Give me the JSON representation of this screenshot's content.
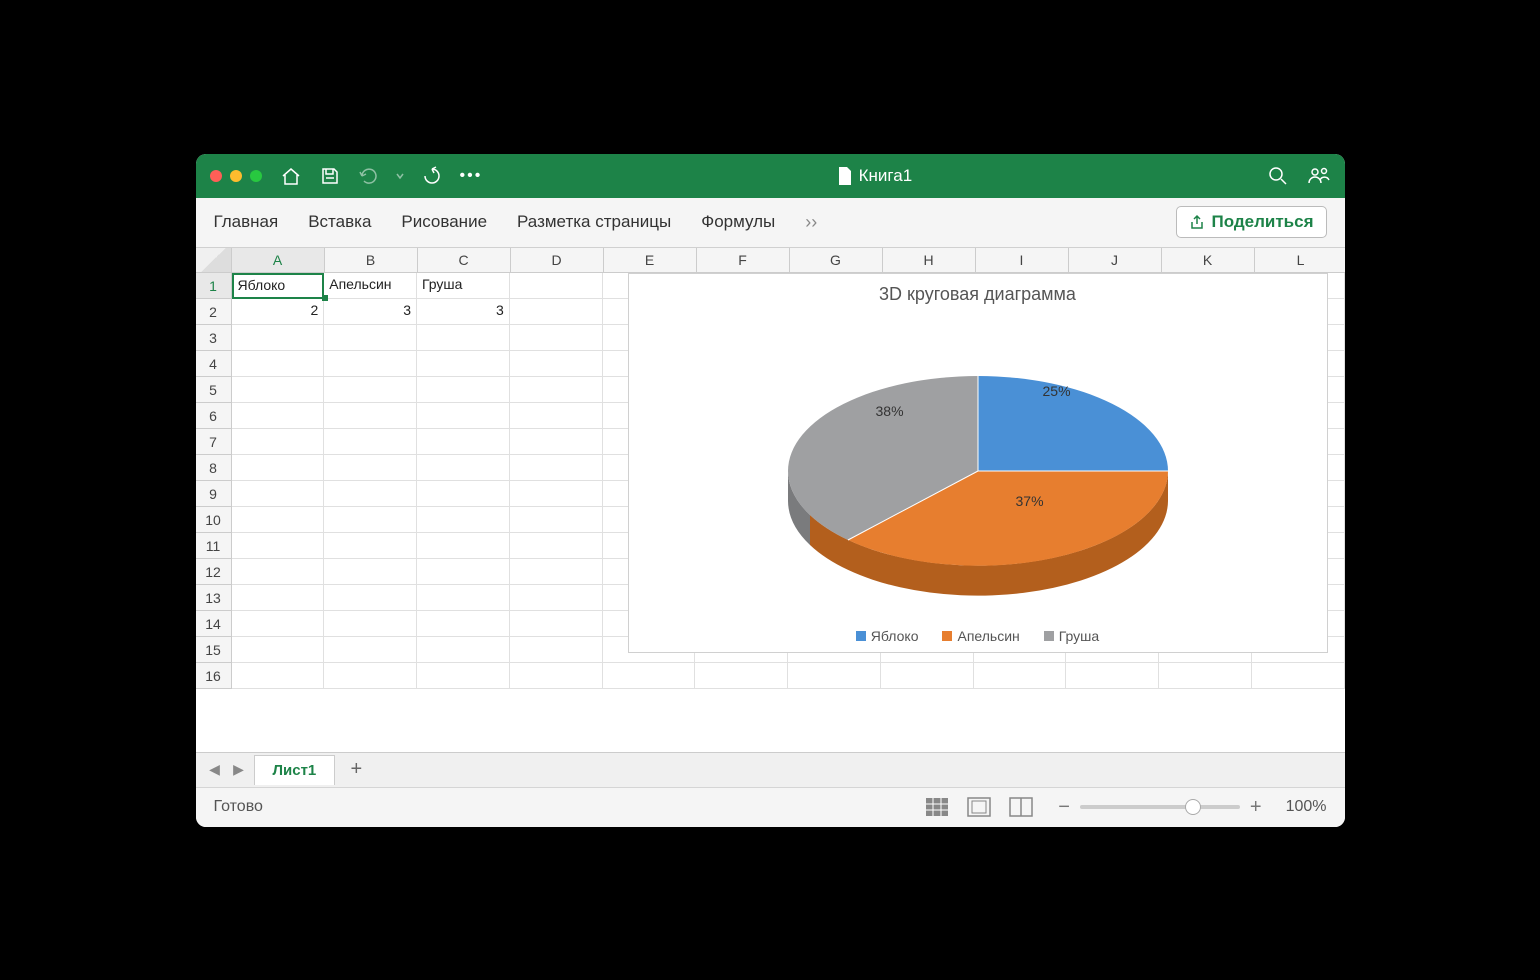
{
  "titlebar": {
    "doc_title": "Книга1"
  },
  "ribbon": {
    "tabs": [
      "Главная",
      "Вставка",
      "Рисование",
      "Разметка страницы",
      "Формулы"
    ],
    "share_label": "Поделиться"
  },
  "columns": [
    "A",
    "B",
    "C",
    "D",
    "E",
    "F",
    "G",
    "H",
    "I",
    "J",
    "K",
    "L"
  ],
  "rows": [
    1,
    2,
    3,
    4,
    5,
    6,
    7,
    8,
    9,
    10,
    11,
    12,
    13,
    14,
    15,
    16
  ],
  "cells": {
    "A1": "Яблоко",
    "B1": "Апельсин",
    "C1": "Груша",
    "A2": "2",
    "B2": "3",
    "C2": "3"
  },
  "selected_cell": "A1",
  "chart": {
    "title": "3D круговая диаграмма",
    "labels": {
      "slice1": "25%",
      "slice2": "37%",
      "slice3": "38%"
    },
    "legend": [
      "Яблоко",
      "Апельсин",
      "Груша"
    ]
  },
  "sheet_tab": "Лист1",
  "status": {
    "ready": "Готово",
    "zoom": "100%"
  },
  "chart_data": {
    "type": "pie",
    "title": "3D круговая диаграмма",
    "categories": [
      "Яблоко",
      "Апельсин",
      "Груша"
    ],
    "values": [
      2,
      3,
      3
    ],
    "percentages": [
      25,
      37,
      38
    ],
    "colors": [
      "#4a90d6",
      "#e77e2f",
      "#9fa0a2"
    ]
  }
}
